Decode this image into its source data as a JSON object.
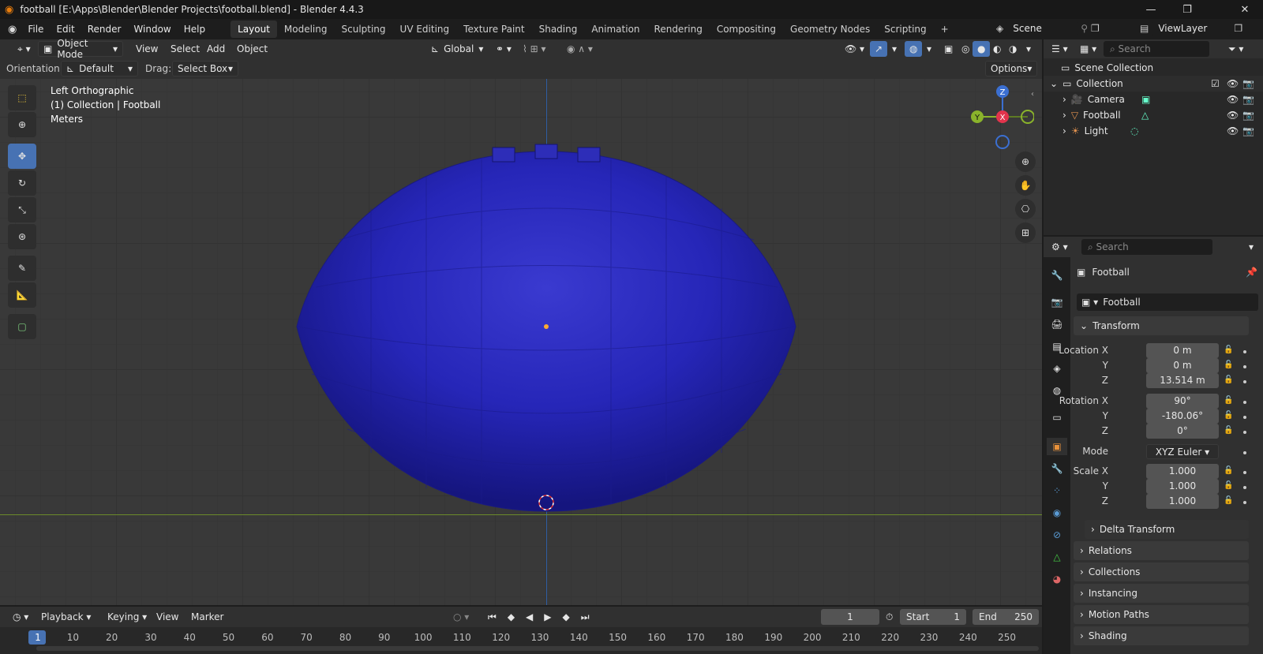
{
  "window": {
    "title": "football [E:\\Apps\\Blender\\Blender Projects\\football.blend] - Blender 4.4.3",
    "min": "—",
    "max": "❐",
    "close": "✕"
  },
  "menu": {
    "items": [
      "File",
      "Edit",
      "Render",
      "Window",
      "Help"
    ]
  },
  "workspaces": {
    "tabs": [
      "Layout",
      "Modeling",
      "Sculpting",
      "UV Editing",
      "Texture Paint",
      "Shading",
      "Animation",
      "Rendering",
      "Compositing",
      "Geometry Nodes",
      "Scripting"
    ],
    "add": "+"
  },
  "scene": {
    "name": "Scene",
    "view_layer": "ViewLayer"
  },
  "viewport_header": {
    "mode": "Object Mode",
    "menus": [
      "View",
      "Select",
      "Add",
      "Object"
    ],
    "transform": "Global"
  },
  "tool_header": {
    "orientation_label": "Orientation:",
    "orientation": "Default",
    "drag_label": "Drag:",
    "drag": "Select Box",
    "options": "Options"
  },
  "viewport": {
    "view_name": "Left Orthographic",
    "collection": "(1) Collection | Football",
    "units": "Meters",
    "colors": {
      "mesh": "#2626b8",
      "bg": "#393939"
    }
  },
  "gizmo": {
    "z": "Z",
    "y": "Y",
    "x": "X"
  },
  "outliner": {
    "search_placeholder": "Search",
    "scene_collection": "Scene Collection",
    "collection": "Collection",
    "objects": [
      "Camera",
      "Football",
      "Light"
    ]
  },
  "properties": {
    "search_placeholder": "Search",
    "object_name": "Football",
    "data_name": "Football",
    "transform": {
      "header": "Transform",
      "location_x_label": "Location X",
      "location_x": "0 m",
      "y_label": "Y",
      "location_y": "0 m",
      "z_label": "Z",
      "location_z": "13.514 m",
      "rotation_x_label": "Rotation X",
      "rotation_x": "90°",
      "rotation_y": "-180.06°",
      "rotation_z": "0°",
      "mode_label": "Mode",
      "mode": "XYZ Euler",
      "scale_x_label": "Scale X",
      "scale_x": "1.000",
      "scale_y": "1.000",
      "scale_z": "1.000",
      "delta": "Delta Transform"
    },
    "panels": [
      "Relations",
      "Collections",
      "Instancing",
      "Motion Paths",
      "Shading"
    ]
  },
  "timeline": {
    "menus": [
      "Playback",
      "Keying",
      "View",
      "Marker"
    ],
    "current_frame": "1",
    "start_label": "Start",
    "start": "1",
    "end_label": "End",
    "end": "250",
    "ticks": [
      "1",
      "10",
      "20",
      "30",
      "40",
      "50",
      "60",
      "70",
      "80",
      "90",
      "100",
      "110",
      "120",
      "130",
      "140",
      "150",
      "160",
      "170",
      "180",
      "190",
      "200",
      "210",
      "220",
      "230",
      "240",
      "250"
    ]
  }
}
